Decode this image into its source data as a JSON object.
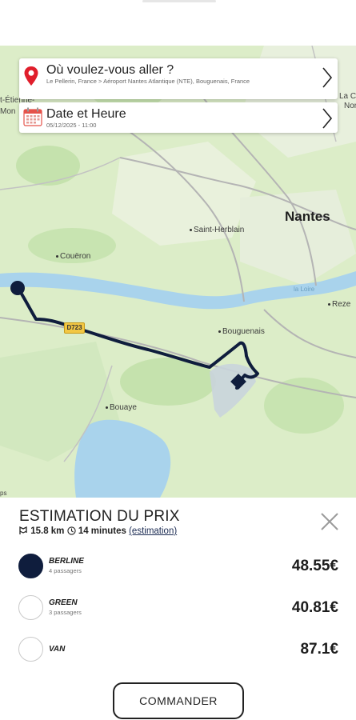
{
  "destination_card": {
    "title": "Où voulez-vous aller ?",
    "route": "Le Pellerin, France > Aéroport Nantes Atlantique (NTE), Bouguenais, France",
    "icon": "map-pin-icon"
  },
  "datetime_card": {
    "title": "Date et Heure",
    "value": "05/12/2025 - 11:00",
    "icon": "calendar-icon"
  },
  "map": {
    "labels": {
      "nantes": "Nantes",
      "saint_herblain": "Saint-Herblain",
      "coueron": "Couëron",
      "bouguenais": "Bouguenais",
      "bouaye": "Bouaye",
      "reze": "Reze",
      "loire": "la Loire",
      "la_cha": "La Cha",
      "nort": "Nort",
      "st_etienne": "t-Étienne-",
      "mon": "Mon",
      "road_badge": "D723",
      "bottom_left": "ps"
    },
    "colors": {
      "route": "#0f1d3d",
      "water": "#a9d3ec",
      "land": "#dcedc8"
    }
  },
  "estimation": {
    "title": "ESTIMATION DU PRIX",
    "distance": "15.8 km",
    "duration": "14 minutes",
    "estimation_link": "(estimation)"
  },
  "options": [
    {
      "name": "BERLINE",
      "passengers": "4 passagers",
      "price": "48.55€",
      "selected": true
    },
    {
      "name": "GREEN",
      "passengers": "3 passagers",
      "price": "40.81€",
      "selected": false
    },
    {
      "name": "VAN",
      "passengers": "",
      "price": "87.1€",
      "selected": false
    }
  ],
  "order_button": "COMMANDER"
}
